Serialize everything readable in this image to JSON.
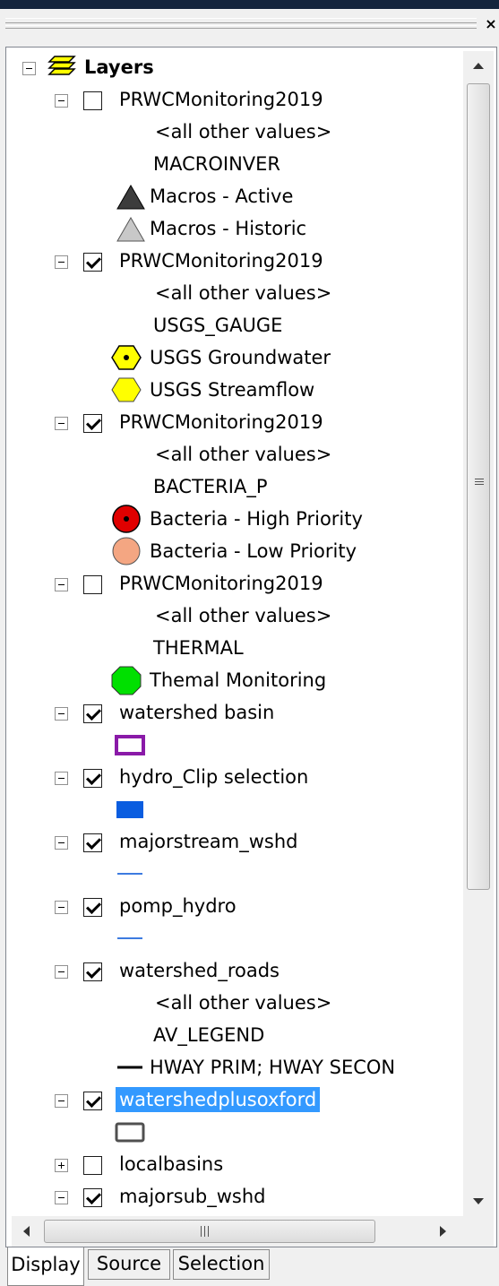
{
  "window": {
    "close_glyph": "×"
  },
  "tree": {
    "root_label": "Layers",
    "layers": [
      {
        "name": "PRWCMonitoring2019",
        "checked": false,
        "field": "MACROINVER",
        "other_values": "<all other values>",
        "classes": [
          "Macros - Active",
          "Macros - Historic"
        ]
      },
      {
        "name": "PRWCMonitoring2019",
        "checked": true,
        "field": "USGS_GAUGE",
        "other_values": "<all other values>",
        "classes": [
          "USGS Groundwater",
          "USGS Streamflow"
        ]
      },
      {
        "name": "PRWCMonitoring2019",
        "checked": true,
        "field": "BACTERIA_P",
        "other_values": "<all other values>",
        "classes": [
          "Bacteria - High Priority",
          "Bacteria - Low Priority"
        ]
      },
      {
        "name": "PRWCMonitoring2019",
        "checked": false,
        "field": "THERMAL",
        "other_values": "<all other values>",
        "classes": [
          "Themal Monitoring"
        ]
      },
      {
        "name": "watershed basin",
        "checked": true
      },
      {
        "name": "hydro_Clip selection",
        "checked": true
      },
      {
        "name": "majorstream_wshd",
        "checked": true
      },
      {
        "name": "pomp_hydro",
        "checked": true
      },
      {
        "name": "watershed_roads",
        "checked": true,
        "field": "AV_LEGEND",
        "other_values": "<all other values>",
        "classes": [
          "HWAY PRIM; HWAY SECON"
        ]
      },
      {
        "name": "watershedplusoxford",
        "checked": true,
        "selected": true
      },
      {
        "name": "localbasins",
        "checked": false,
        "collapsed": true
      },
      {
        "name": "majorsub_wshd",
        "checked": true
      }
    ]
  },
  "colors": {
    "selection": "#3399ff",
    "macros_active": "#3c3c3c",
    "macros_historic": "#c8c8c8",
    "usgs": "#ffff00",
    "bacteria_high": "#e00000",
    "bacteria_low": "#f4a682",
    "thermal": "#00e000",
    "watershed_basin": "#8a1aa8",
    "hydro_clip": "#0a5de0",
    "stream_line": "#3d7be0",
    "road_line": "#000000",
    "oxford_outline": "#505050"
  },
  "scrollbar": {
    "grip_glyph": "III"
  },
  "tabs": {
    "display": "Display",
    "source": "Source",
    "selection": "Selection",
    "active": "Display"
  }
}
